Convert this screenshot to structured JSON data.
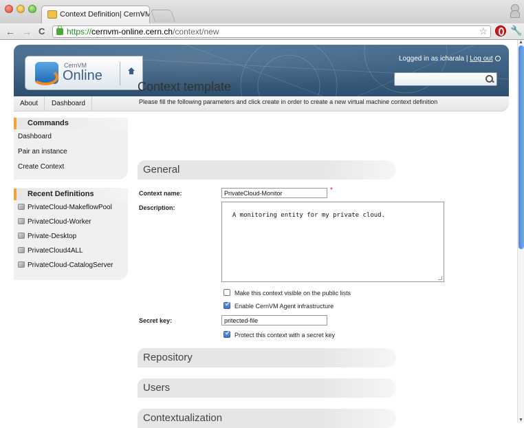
{
  "browser": {
    "tab_title": "Context Definition| CernVM",
    "tab_close": "×",
    "url_https": "https://",
    "url_host": "cernvm-online.cern.ch",
    "url_path": "/context/new",
    "back": "←",
    "forward": "→",
    "reload": "C",
    "star": "☆",
    "wrench": "🔧"
  },
  "header": {
    "logo_small": "CernVM",
    "logo_big": "Online",
    "logged_in_text": "Logged in as icharala | ",
    "logout_label": "Log out"
  },
  "menu": [
    {
      "label": "About"
    },
    {
      "label": "Dashboard"
    }
  ],
  "sidebar": {
    "commands_title": "Commands",
    "commands": [
      {
        "label": "Dashboard"
      },
      {
        "label": "Pair an instance"
      },
      {
        "label": "Create Context"
      }
    ],
    "recent_title": "Recent Definitions",
    "recent": [
      {
        "label": "PrivateCloud-MakeflowPool"
      },
      {
        "label": "PrivateCloud-Worker"
      },
      {
        "label": "Private-Desktop"
      },
      {
        "label": "PrivateCloud4ALL"
      },
      {
        "label": "PrivateCloud-CatalogServer"
      }
    ]
  },
  "main": {
    "title": "Context template",
    "intro": "Please fill the following parameters and click create in order to create a new virtual machine context definition",
    "sections": {
      "general": "General",
      "repository": "Repository",
      "users": "Users",
      "contextualization": "Contextualization"
    },
    "form": {
      "context_name_label": "Context name:",
      "context_name_value": "PrivateCloud-Monitor",
      "required_mark": "*",
      "description_label": "Description:",
      "description_value": "A monitoring entity for my private cloud.",
      "visible_public_label": "Make this context visible on the public lists",
      "visible_public_checked": false,
      "agent_label": "Enable CernVM Agent infrastructure",
      "agent_checked": true,
      "secret_key_label": "Secret key:",
      "secret_key_value": "pritected-file",
      "protect_label": "Protect this context with a secret key",
      "protect_checked": true
    }
  }
}
